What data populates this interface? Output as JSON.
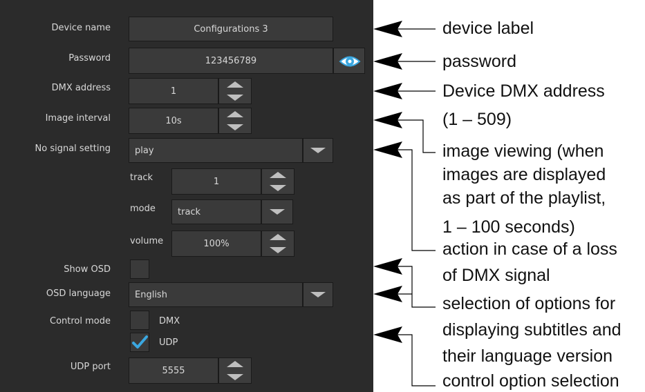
{
  "form": {
    "device_name": {
      "label": "Device name",
      "value": "Configurations 3"
    },
    "password": {
      "label": "Password",
      "value": "123456789"
    },
    "dmx_address": {
      "label": "DMX address",
      "value": "1"
    },
    "image_interval": {
      "label": "Image interval",
      "value": "10s"
    },
    "no_signal": {
      "label": "No signal setting",
      "value": "play",
      "track": {
        "label": "track",
        "value": "1"
      },
      "mode": {
        "label": "mode",
        "value": "track"
      },
      "volume": {
        "label": "volume",
        "value": "100%"
      }
    },
    "show_osd": {
      "label": "Show OSD",
      "checked": false
    },
    "osd_language": {
      "label": "OSD language",
      "value": "English"
    },
    "control_mode": {
      "label": "Control mode",
      "dmx": {
        "label": "DMX",
        "checked": false
      },
      "udp": {
        "label": "UDP",
        "checked": true
      }
    },
    "udp_port": {
      "label": "UDP port",
      "value": "5555"
    }
  },
  "colors": {
    "panel": "#2b2b2b",
    "field": "#3a3a3a",
    "eye": "#3aa7e0",
    "check": "#3aa7e0"
  },
  "annotations": [
    "device label",
    "password",
    "Device DMX address",
    "(1 – 509)",
    "image viewing (when",
    "images are displayed",
    "as part of the playlist,",
    "1 – 100 seconds)",
    "action in case of a loss",
    "of DMX signal",
    "selection of options for",
    "displaying subtitles and",
    "their language version",
    "control option selection"
  ]
}
